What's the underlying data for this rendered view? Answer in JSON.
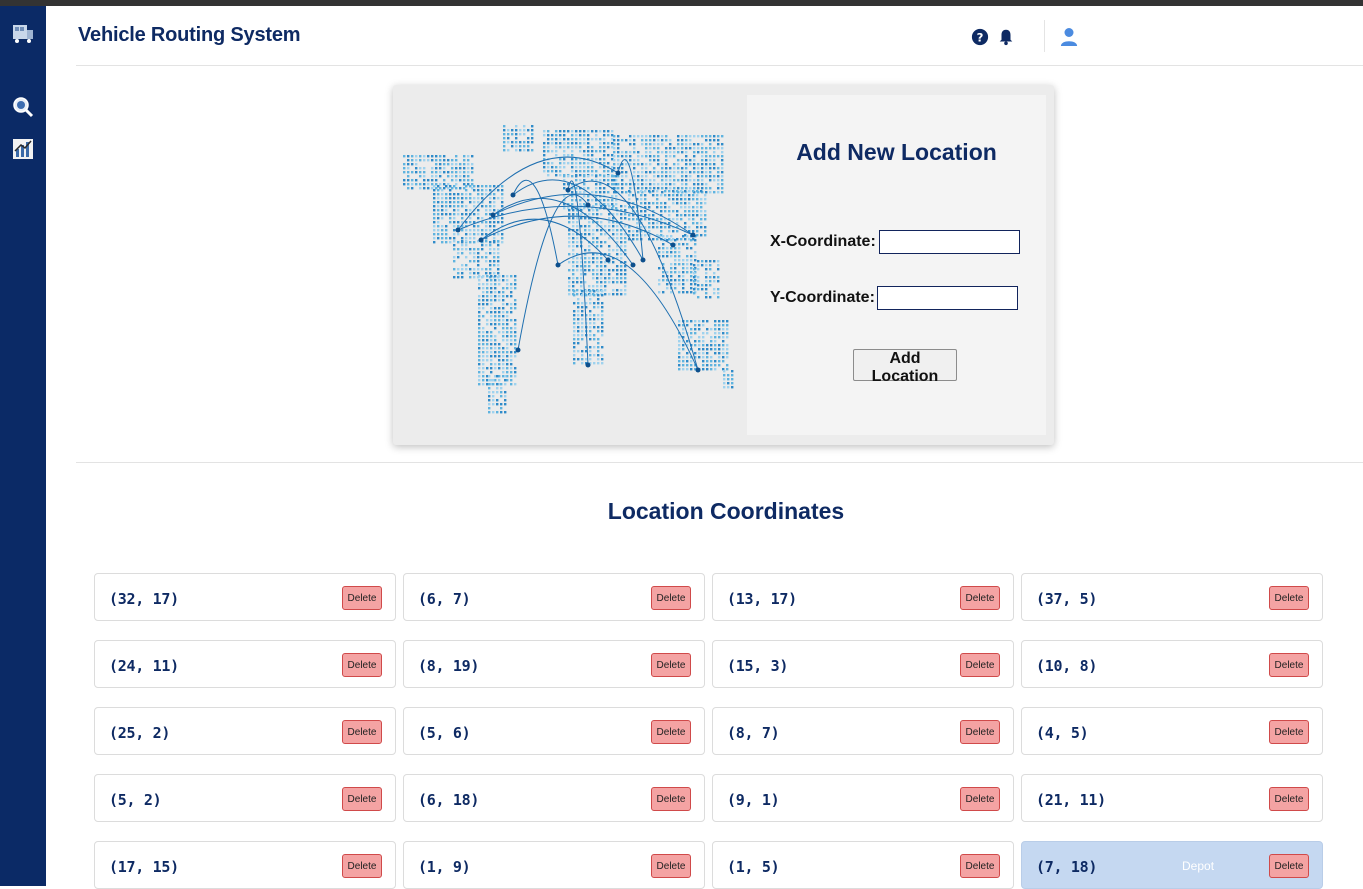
{
  "app": {
    "title": "Vehicle Routing System"
  },
  "sidebar": {
    "items": [
      {
        "name": "truck-logo-icon"
      },
      {
        "name": "search-analytics-icon"
      },
      {
        "name": "chart-icon"
      }
    ]
  },
  "header": {
    "icons": [
      "help-icon",
      "bell-icon",
      "user-avatar-icon"
    ]
  },
  "form": {
    "title": "Add New Location",
    "x_label": "X-Coordinate:",
    "y_label": "Y-Coordinate:",
    "x_value": "",
    "y_value": "",
    "submit_label": "Add Location"
  },
  "locations_section": {
    "title": "Location Coordinates",
    "delete_label": "Delete",
    "depot_label": "Depot",
    "items": [
      "(32, 17)",
      "(6, 7)",
      "(13, 17)",
      "(37, 5)",
      "(24, 11)",
      "(8, 19)",
      "(15, 3)",
      "(10, 8)",
      "(25, 2)",
      "(5, 6)",
      "(8, 7)",
      "(4, 5)",
      "(5, 2)",
      "(6, 18)",
      "(9, 1)",
      "(21, 11)",
      "(17, 15)",
      "(1, 9)",
      "(1, 5)",
      "(7, 18)"
    ],
    "depot_index": 19
  },
  "colors": {
    "sidebar": "#0b2a66",
    "title": "#0e2a63",
    "delete_bg": "#f4a3a3",
    "depot_bg": "#c5d8f1"
  }
}
